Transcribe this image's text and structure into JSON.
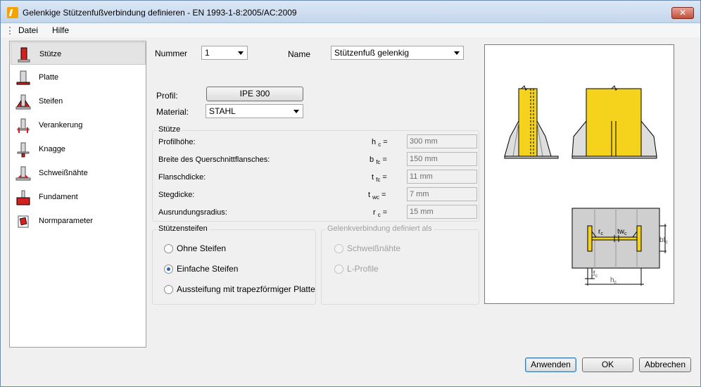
{
  "window": {
    "title": "Gelenkige Stützenfußverbindung definieren - EN 1993-1-8:2005/AC:2009",
    "close_symbol": "✕"
  },
  "menu": {
    "items": [
      "Datei",
      "Hilfe"
    ]
  },
  "sidebar": {
    "items": [
      {
        "label": "Stütze",
        "icon": "column-icon",
        "selected": true
      },
      {
        "label": "Platte",
        "icon": "base-plate-icon"
      },
      {
        "label": "Steifen",
        "icon": "stiffener-icon"
      },
      {
        "label": "Verankerung",
        "icon": "anchorage-icon"
      },
      {
        "label": "Knagge",
        "icon": "shear-lug-icon"
      },
      {
        "label": "Schweißnähte",
        "icon": "weld-icon"
      },
      {
        "label": "Fundament",
        "icon": "foundation-icon"
      },
      {
        "label": "Normparameter",
        "icon": "code-parameters-icon"
      }
    ]
  },
  "header": {
    "number_label": "Nummer",
    "number_value": "1",
    "name_label": "Name",
    "name_value": "Stützenfuß gelenkig"
  },
  "profile": {
    "profile_label": "Profil:",
    "profile_button": "IPE 300",
    "material_label": "Material:",
    "material_value": "STAHL"
  },
  "column_group": {
    "title": "Stütze",
    "rows": [
      {
        "label": "Profilhöhe:",
        "sym": "h",
        "sub": "c",
        "value": "300 mm"
      },
      {
        "label": "Breite des Querschnittflansches:",
        "sym": "b",
        "sub": "fc",
        "value": "150 mm"
      },
      {
        "label": "Flanschdicke:",
        "sym": "t",
        "sub": "fc",
        "value": "11 mm"
      },
      {
        "label": "Stegdicke:",
        "sym": "t",
        "sub": "wc",
        "value": "7 mm"
      },
      {
        "label": "Ausrundungsradius:",
        "sym": "r",
        "sub": "c",
        "value": "15 mm"
      }
    ],
    "equals": "="
  },
  "stiffeners_group": {
    "title": "Stützensteifen",
    "options": [
      {
        "label": "Ohne Steifen",
        "checked": false
      },
      {
        "label": "Einfache Steifen",
        "checked": true
      },
      {
        "label": "Aussteifung mit trapezförmiger Platte",
        "checked": false
      }
    ]
  },
  "connection_group": {
    "title": "Gelenkverbindung definiert als",
    "options": [
      {
        "label": "Schweißnähte",
        "checked": true
      },
      {
        "label": "L-Profile",
        "checked": false
      }
    ]
  },
  "preview": {
    "labels": {
      "rc": "r",
      "rc_sub": "c",
      "twc": "tw",
      "twc_sub": "c",
      "bfc": "bf",
      "bfc_sub": "c",
      "tfc": "tf",
      "tfc_sub": "c",
      "hc": "h",
      "hc_sub": "c"
    },
    "colors": {
      "steel": "#f5d31d",
      "plate": "#c8c8c8",
      "outline": "#000000"
    }
  },
  "buttons": {
    "apply": "Anwenden",
    "ok": "OK",
    "cancel": "Abbrechen"
  }
}
